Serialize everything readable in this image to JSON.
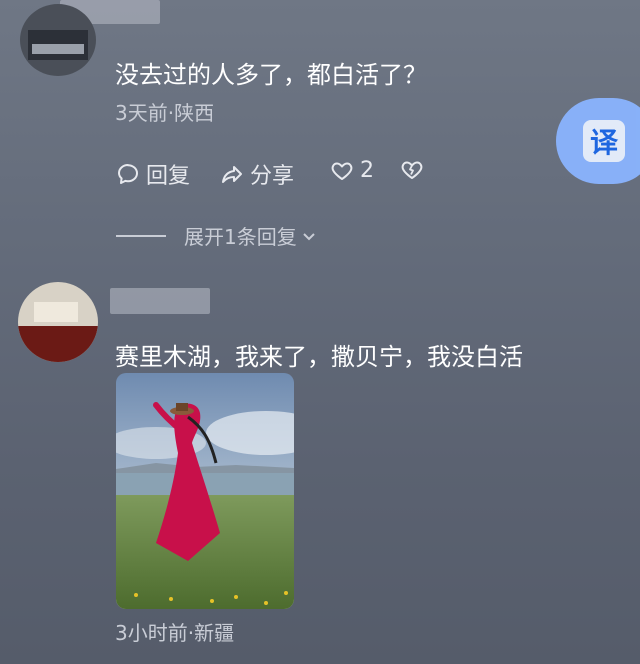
{
  "comments": [
    {
      "text": "没去过的人多了，都白活了？",
      "meta": "3天前·陕西",
      "actions": {
        "reply_label": "回复",
        "share_label": "分享",
        "like_count": "2"
      },
      "expand_replies_label": "展开1条回复"
    },
    {
      "text": "赛里木湖，我来了，撒贝宁，我没白活",
      "meta": "3小时前·新疆"
    }
  ],
  "translate_button": {
    "label": "译"
  },
  "colors": {
    "translate_bg": "#8ab4ff",
    "translate_text": "#1b66e6",
    "dress": "#d0114a"
  }
}
